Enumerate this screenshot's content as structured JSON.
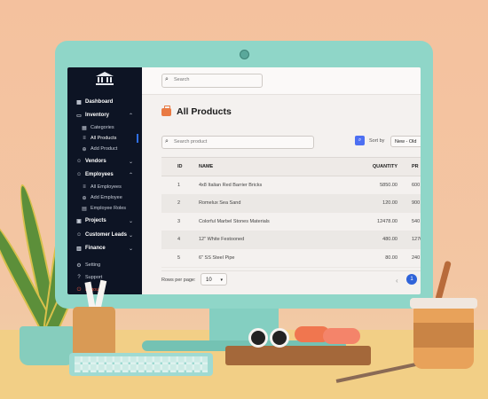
{
  "sidebar": {
    "items": [
      {
        "label": "Dashboard",
        "icon": "grid-icon"
      },
      {
        "label": "Inventory",
        "icon": "folder-icon"
      },
      {
        "label": "Categories",
        "icon": "grid-icon"
      },
      {
        "label": "All Products",
        "icon": "list-icon"
      },
      {
        "label": "Add Product",
        "icon": "plus-circle-icon"
      },
      {
        "label": "Vendors",
        "icon": "users-icon"
      },
      {
        "label": "Employees",
        "icon": "users-icon"
      },
      {
        "label": "All Employees",
        "icon": "list-icon"
      },
      {
        "label": "Add Employee",
        "icon": "user-plus-icon"
      },
      {
        "label": "Employee Roles",
        "icon": "id-card-icon"
      },
      {
        "label": "Projects",
        "icon": "briefcase-icon"
      },
      {
        "label": "Customer Leads",
        "icon": "users-icon"
      },
      {
        "label": "Finance",
        "icon": "chart-icon"
      },
      {
        "label": "Setting",
        "icon": "gear-icon"
      },
      {
        "label": "Support",
        "icon": "help-icon"
      },
      {
        "label": "Logout",
        "icon": "logout-icon"
      }
    ]
  },
  "search": {
    "placeholder": "Search"
  },
  "page": {
    "title": "All Products"
  },
  "product_search": {
    "placeholder": "Search product"
  },
  "sort": {
    "label": "Sort by",
    "value": "New - Old"
  },
  "table": {
    "headers": {
      "id": "ID",
      "name": "NAME",
      "quantity": "QUANTITY",
      "price": "PR"
    },
    "rows": [
      {
        "id": "1",
        "name": "4x8 Italian Red Barrier Bricks",
        "quantity": "5850.00",
        "price": "600"
      },
      {
        "id": "2",
        "name": "Romelux Sea Sand",
        "quantity": "120.00",
        "price": "900"
      },
      {
        "id": "3",
        "name": "Colorful Marbel Stones Materials",
        "quantity": "12478.00",
        "price": "540"
      },
      {
        "id": "4",
        "name": "12\" White Festooned",
        "quantity": "480.00",
        "price": "1270"
      },
      {
        "id": "5",
        "name": "6\" SS Steel Pipe",
        "quantity": "80.00",
        "price": "240"
      }
    ]
  },
  "pagination": {
    "rows_label": "Rows per page:",
    "rows_value": "10",
    "current_page": "1"
  },
  "colors": {
    "sidebar_bg": "#0d1424",
    "accent": "#2f63d9",
    "brand_icon": "#e97a43"
  }
}
